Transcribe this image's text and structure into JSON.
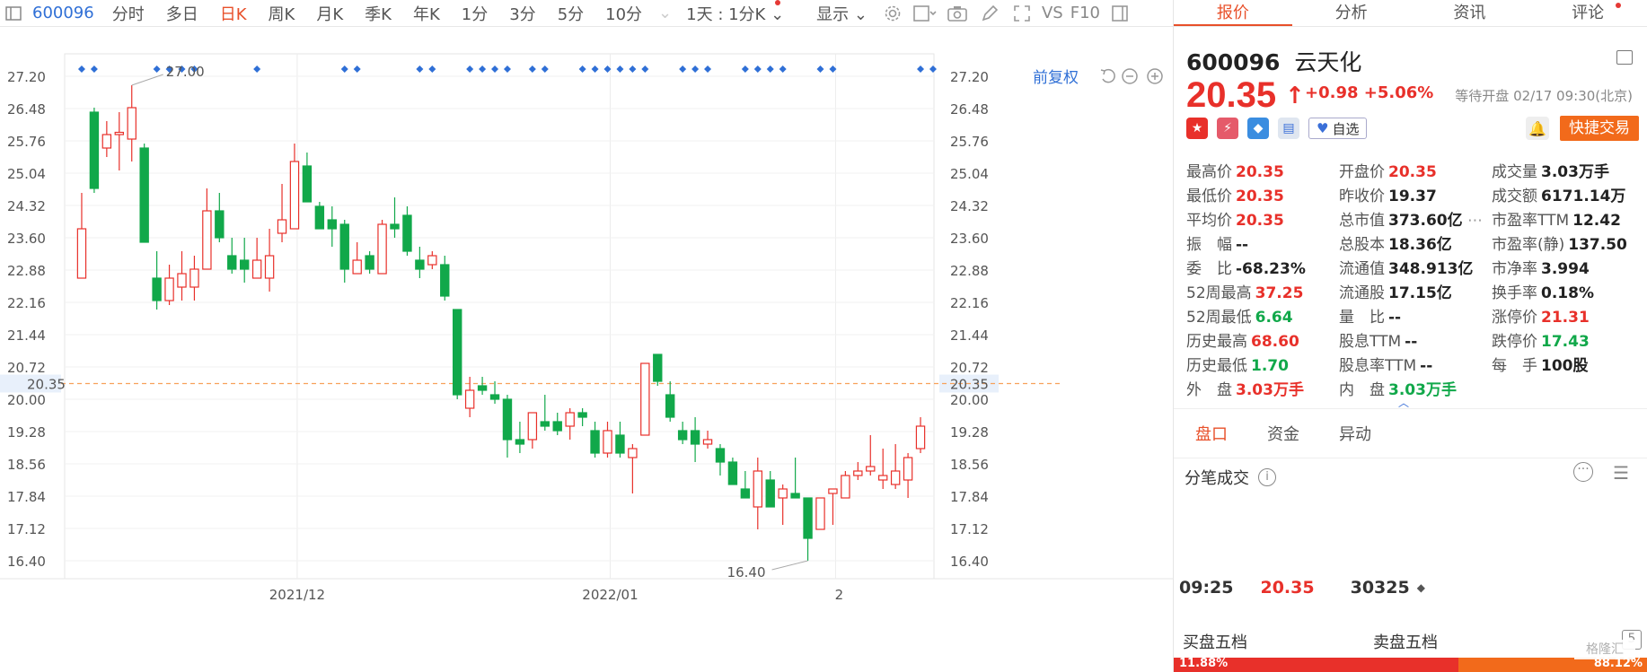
{
  "toolbar": {
    "code": "600096",
    "tabs": [
      "分时",
      "多日",
      "日K",
      "周K",
      "月K",
      "季K",
      "年K",
      "1分",
      "3分",
      "5分",
      "10分"
    ],
    "active_tab": "日K",
    "period_dropdown": "1天 : 1分K",
    "display_dropdown": "显示",
    "vs_label": "VS",
    "f10_label": "F10",
    "restoration_label": "前复权"
  },
  "chart_data": {
    "type": "candlestick",
    "y_ticks": [
      27.2,
      26.48,
      25.76,
      25.04,
      24.32,
      23.6,
      22.88,
      22.16,
      21.44,
      20.72,
      20.0,
      19.28,
      18.56,
      17.84,
      17.12,
      16.4
    ],
    "ylim": [
      16.0,
      27.7
    ],
    "x_tick_labels": [
      "2021/12",
      "2022/01",
      "2"
    ],
    "current_price_label": "20.35",
    "high_annotation": "27.00",
    "low_annotation": "16.40",
    "colors": {
      "up": "#e8302a",
      "down": "#11a84a",
      "marker": "#2f6fd6",
      "price_line": "#f7a15a"
    },
    "candles": [
      {
        "o": 22.7,
        "c": 23.8,
        "h": 24.6,
        "l": 23.6
      },
      {
        "o": 26.4,
        "c": 24.7,
        "h": 26.5,
        "l": 24.6
      },
      {
        "o": 25.6,
        "c": 25.9,
        "h": 26.2,
        "l": 25.4
      },
      {
        "o": 25.9,
        "c": 25.95,
        "h": 26.4,
        "l": 25.1
      },
      {
        "o": 25.8,
        "c": 26.5,
        "h": 27.0,
        "l": 25.3
      },
      {
        "o": 25.6,
        "c": 23.5,
        "h": 25.7,
        "l": 23.5
      },
      {
        "o": 22.7,
        "c": 22.2,
        "h": 23.3,
        "l": 22.0
      },
      {
        "o": 22.2,
        "c": 22.7,
        "h": 23.0,
        "l": 22.1
      },
      {
        "o": 22.5,
        "c": 22.8,
        "h": 23.3,
        "l": 22.2
      },
      {
        "o": 22.5,
        "c": 22.9,
        "h": 23.2,
        "l": 22.2
      },
      {
        "o": 22.9,
        "c": 24.2,
        "h": 24.7,
        "l": 22.9
      },
      {
        "o": 24.2,
        "c": 23.6,
        "h": 24.6,
        "l": 23.5
      },
      {
        "o": 23.2,
        "c": 22.9,
        "h": 23.6,
        "l": 22.8
      },
      {
        "o": 23.1,
        "c": 22.9,
        "h": 23.6,
        "l": 22.6
      },
      {
        "o": 22.7,
        "c": 23.1,
        "h": 23.6,
        "l": 22.7
      },
      {
        "o": 22.7,
        "c": 23.2,
        "h": 23.8,
        "l": 22.4
      },
      {
        "o": 23.7,
        "c": 24.0,
        "h": 24.8,
        "l": 23.5
      },
      {
        "o": 23.8,
        "c": 25.3,
        "h": 25.7,
        "l": 23.8
      },
      {
        "o": 25.2,
        "c": 24.4,
        "h": 25.5,
        "l": 24.4
      },
      {
        "o": 24.3,
        "c": 23.8,
        "h": 24.4,
        "l": 23.8
      },
      {
        "o": 24.0,
        "c": 23.8,
        "h": 24.3,
        "l": 23.4
      },
      {
        "o": 23.9,
        "c": 22.9,
        "h": 24.0,
        "l": 22.6
      },
      {
        "o": 22.8,
        "c": 23.1,
        "h": 23.5,
        "l": 22.8
      },
      {
        "o": 23.2,
        "c": 22.9,
        "h": 23.3,
        "l": 22.8
      },
      {
        "o": 22.8,
        "c": 23.9,
        "h": 24.0,
        "l": 22.8
      },
      {
        "o": 23.9,
        "c": 23.8,
        "h": 24.5,
        "l": 23.6
      },
      {
        "o": 24.1,
        "c": 23.3,
        "h": 24.3,
        "l": 23.2
      },
      {
        "o": 23.1,
        "c": 22.9,
        "h": 23.4,
        "l": 22.7
      },
      {
        "o": 23.0,
        "c": 23.2,
        "h": 23.3,
        "l": 22.9
      },
      {
        "o": 23.0,
        "c": 22.3,
        "h": 23.2,
        "l": 22.2
      },
      {
        "o": 22.0,
        "c": 20.1,
        "h": 22.0,
        "l": 20.0
      },
      {
        "o": 19.8,
        "c": 20.2,
        "h": 20.5,
        "l": 19.6
      },
      {
        "o": 20.3,
        "c": 20.2,
        "h": 20.5,
        "l": 20.1
      },
      {
        "o": 20.1,
        "c": 20.0,
        "h": 20.4,
        "l": 19.9
      },
      {
        "o": 20.0,
        "c": 19.1,
        "h": 20.1,
        "l": 18.7
      },
      {
        "o": 19.1,
        "c": 19.0,
        "h": 19.5,
        "l": 18.8
      },
      {
        "o": 19.1,
        "c": 19.7,
        "h": 19.7,
        "l": 18.9
      },
      {
        "o": 19.5,
        "c": 19.4,
        "h": 20.1,
        "l": 19.3
      },
      {
        "o": 19.5,
        "c": 19.3,
        "h": 19.7,
        "l": 19.2
      },
      {
        "o": 19.4,
        "c": 19.7,
        "h": 19.8,
        "l": 19.1
      },
      {
        "o": 19.7,
        "c": 19.6,
        "h": 19.8,
        "l": 19.4
      },
      {
        "o": 19.3,
        "c": 18.8,
        "h": 19.5,
        "l": 18.7
      },
      {
        "o": 18.8,
        "c": 19.3,
        "h": 19.5,
        "l": 18.7
      },
      {
        "o": 19.2,
        "c": 18.8,
        "h": 19.5,
        "l": 18.7
      },
      {
        "o": 18.7,
        "c": 18.9,
        "h": 19.0,
        "l": 17.9
      },
      {
        "o": 19.2,
        "c": 20.8,
        "h": 20.8,
        "l": 19.2
      },
      {
        "o": 21.0,
        "c": 20.4,
        "h": 21.0,
        "l": 20.3
      },
      {
        "o": 20.1,
        "c": 19.6,
        "h": 20.4,
        "l": 19.5
      },
      {
        "o": 19.3,
        "c": 19.1,
        "h": 19.5,
        "l": 19.0
      },
      {
        "o": 19.3,
        "c": 19.0,
        "h": 19.6,
        "l": 18.6
      },
      {
        "o": 19.0,
        "c": 19.1,
        "h": 19.3,
        "l": 18.9
      },
      {
        "o": 18.9,
        "c": 18.6,
        "h": 19.0,
        "l": 18.3
      },
      {
        "o": 18.6,
        "c": 18.1,
        "h": 18.7,
        "l": 18.1
      },
      {
        "o": 18.0,
        "c": 17.8,
        "h": 18.4,
        "l": 17.8
      },
      {
        "o": 17.6,
        "c": 18.4,
        "h": 18.7,
        "l": 17.1
      },
      {
        "o": 18.2,
        "c": 17.6,
        "h": 18.4,
        "l": 17.6
      },
      {
        "o": 17.8,
        "c": 18.0,
        "h": 18.1,
        "l": 17.2
      },
      {
        "o": 17.9,
        "c": 17.8,
        "h": 18.7,
        "l": 17.8
      },
      {
        "o": 17.8,
        "c": 16.9,
        "h": 17.8,
        "l": 16.4
      },
      {
        "o": 17.1,
        "c": 17.8,
        "h": 17.8,
        "l": 17.1
      },
      {
        "o": 17.9,
        "c": 18.0,
        "h": 18.0,
        "l": 17.2
      },
      {
        "o": 17.8,
        "c": 18.3,
        "h": 18.4,
        "l": 17.8
      },
      {
        "o": 18.3,
        "c": 18.4,
        "h": 18.6,
        "l": 18.2
      },
      {
        "o": 18.4,
        "c": 18.5,
        "h": 19.2,
        "l": 18.3
      },
      {
        "o": 18.2,
        "c": 18.3,
        "h": 18.9,
        "l": 18.0
      },
      {
        "o": 18.1,
        "c": 18.4,
        "h": 19.0,
        "l": 18.0
      },
      {
        "o": 18.2,
        "c": 18.7,
        "h": 18.8,
        "l": 17.8
      },
      {
        "o": 18.9,
        "c": 19.4,
        "h": 19.6,
        "l": 18.8
      }
    ],
    "markers": [
      0,
      1,
      6,
      7,
      8,
      9,
      14,
      21,
      22,
      27,
      28,
      31,
      32,
      33,
      34,
      36,
      37,
      40,
      41,
      42,
      43,
      44,
      45,
      48,
      49,
      50,
      53,
      54,
      55,
      56,
      59,
      60,
      67,
      68
    ]
  },
  "panel": {
    "tabs": [
      "报价",
      "分析",
      "资讯",
      "评论"
    ],
    "active_tab": "报价",
    "code": "600096",
    "name": "云天化",
    "price": "20.35",
    "change": "+0.98",
    "change_pct": "+5.06%",
    "status": "等待开盘 02/17 09:30(北京)",
    "watch_label": "自选",
    "quick_trade": "快捷交易",
    "stats": [
      [
        {
          "label": "最高价",
          "value": "20.35",
          "cls": "up"
        },
        {
          "label": "开盘价",
          "value": "20.35",
          "cls": "up"
        },
        {
          "label": "成交量",
          "value": "3.03万手",
          "cls": ""
        }
      ],
      [
        {
          "label": "最低价",
          "value": "20.35",
          "cls": "up"
        },
        {
          "label": "昨收价",
          "value": "19.37",
          "cls": ""
        },
        {
          "label": "成交额",
          "value": "6171.14万",
          "cls": ""
        }
      ],
      [
        {
          "label": "平均价",
          "value": "20.35",
          "cls": "up"
        },
        {
          "label": "总市值",
          "value": "373.60亿",
          "cls": ""
        },
        {
          "label": "市盈率TTM",
          "value": "12.42",
          "cls": ""
        }
      ],
      [
        {
          "label": "振　幅",
          "value": "--",
          "cls": ""
        },
        {
          "label": "总股本",
          "value": "18.36亿",
          "cls": ""
        },
        {
          "label": "市盈率(静)",
          "value": "137.50",
          "cls": ""
        }
      ],
      [
        {
          "label": "委　比",
          "value": "-68.23%",
          "cls": ""
        },
        {
          "label": "流通值",
          "value": "348.913亿",
          "cls": ""
        },
        {
          "label": "市净率",
          "value": "3.994",
          "cls": ""
        }
      ],
      [
        {
          "label": "52周最高",
          "value": "37.25",
          "cls": "up"
        },
        {
          "label": "流通股",
          "value": "17.15亿",
          "cls": ""
        },
        {
          "label": "换手率",
          "value": "0.18%",
          "cls": ""
        }
      ],
      [
        {
          "label": "52周最低",
          "value": "6.64",
          "cls": "dn"
        },
        {
          "label": "量　比",
          "value": "--",
          "cls": ""
        },
        {
          "label": "涨停价",
          "value": "21.31",
          "cls": "up"
        }
      ],
      [
        {
          "label": "历史最高",
          "value": "68.60",
          "cls": "up"
        },
        {
          "label": "股息TTM",
          "value": "--",
          "cls": ""
        },
        {
          "label": "跌停价",
          "value": "17.43",
          "cls": "dn"
        }
      ],
      [
        {
          "label": "历史最低",
          "value": "1.70",
          "cls": "dn"
        },
        {
          "label": "股息率TTM",
          "value": "--",
          "cls": ""
        },
        {
          "label": "每　手",
          "value": "100股",
          "cls": ""
        }
      ],
      [
        {
          "label": "外　盘",
          "value": "3.03万手",
          "cls": "up"
        },
        {
          "label": "内　盘",
          "value": "3.03万手",
          "cls": "dn"
        },
        {
          "label": "",
          "value": "",
          "cls": ""
        }
      ]
    ],
    "subtabs": [
      "盘口",
      "资金",
      "异动"
    ],
    "active_subtab": "盘口",
    "tick_title": "分笔成交",
    "deal": {
      "time": "09:25",
      "price": "20.35",
      "volume": "30325"
    },
    "buy5": "买盘五档",
    "sell5": "卖盘五档",
    "bar_left": "11.88%",
    "bar_right": "88.12%"
  }
}
